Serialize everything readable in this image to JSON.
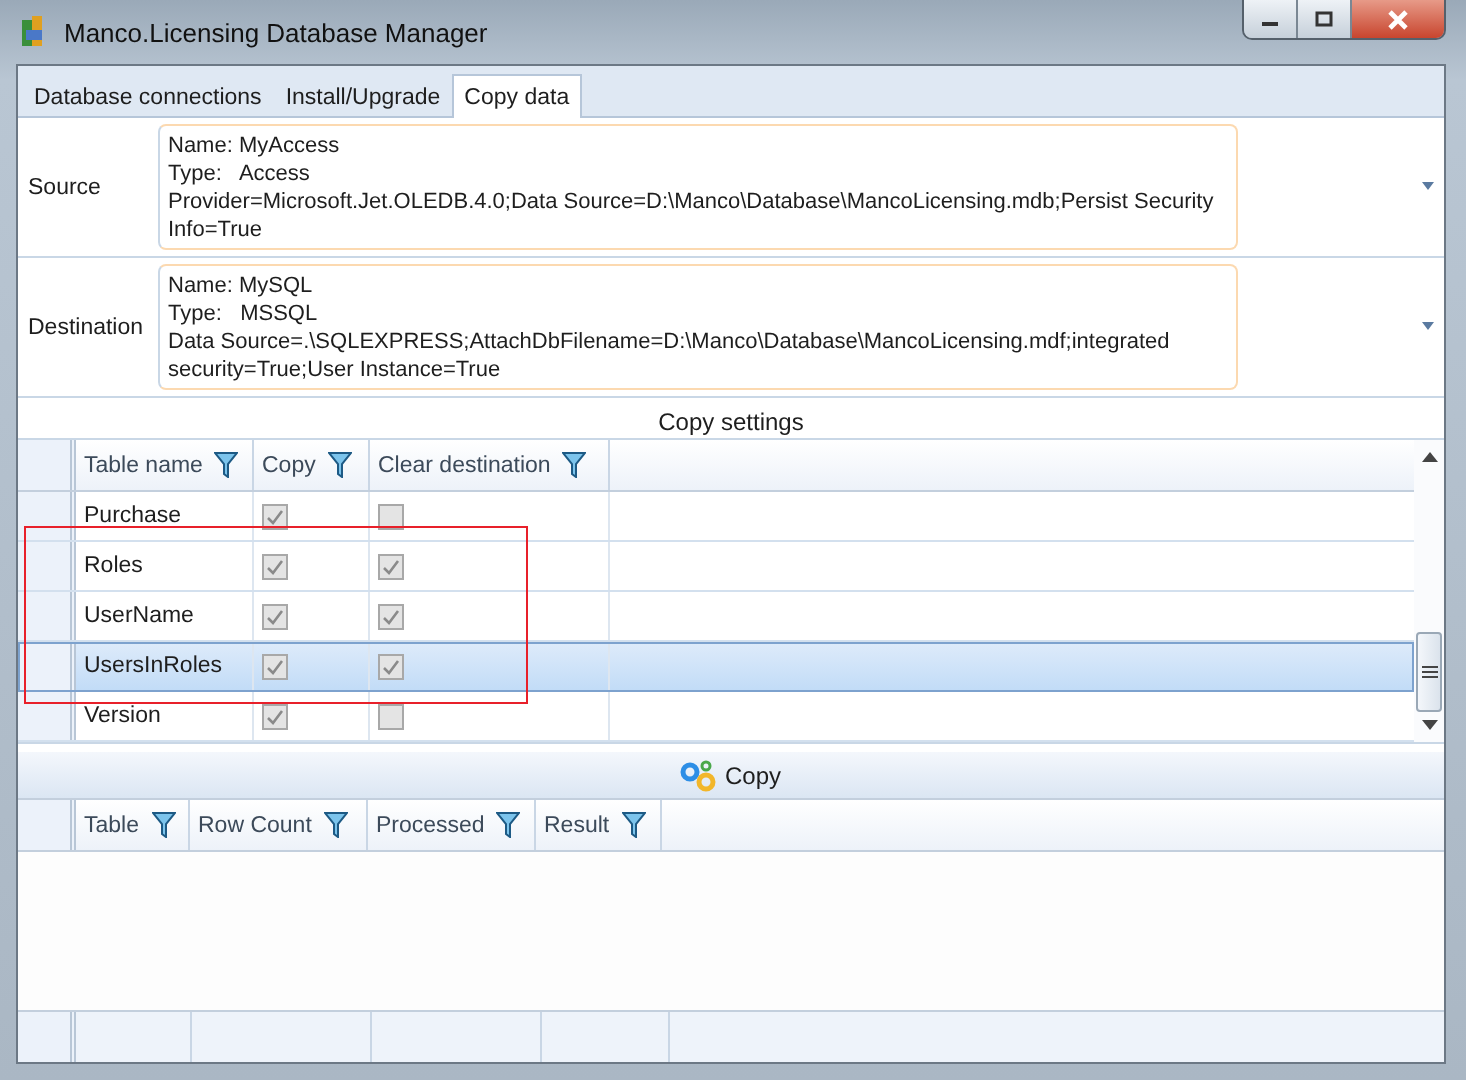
{
  "window": {
    "title": "Manco.Licensing Database Manager"
  },
  "tabs": [
    {
      "label": "Database connections",
      "selected": false
    },
    {
      "label": "Install/Upgrade",
      "selected": false
    },
    {
      "label": "Copy data",
      "selected": true
    }
  ],
  "connections": [
    {
      "label": "Source",
      "lines": [
        "Name: MyAccess",
        "Type:   Access",
        "Provider=Microsoft.Jet.OLEDB.4.0;Data Source=D:\\Manco\\Database\\MancoLicensing.mdb;Persist Security Info=True"
      ]
    },
    {
      "label": "Destination",
      "lines": [
        "Name: MySQL",
        "Type:   MSSQL",
        "Data Source=.\\SQLEXPRESS;AttachDbFilename=D:\\Manco\\Database\\MancoLicensing.mdf;integrated security=True;User Instance=True"
      ]
    }
  ],
  "copy_settings": {
    "title": "Copy settings",
    "columns": [
      "Table name",
      "Copy",
      "Clear destination"
    ],
    "rows": [
      {
        "name": "Purchase",
        "copy": true,
        "clear": false,
        "selected": false
      },
      {
        "name": "Roles",
        "copy": true,
        "clear": true,
        "selected": false
      },
      {
        "name": "UserName",
        "copy": true,
        "clear": true,
        "selected": false
      },
      {
        "name": "UsersInRoles",
        "copy": true,
        "clear": true,
        "selected": true
      },
      {
        "name": "Version",
        "copy": true,
        "clear": false,
        "selected": false
      }
    ]
  },
  "copy_button": {
    "label": "Copy"
  },
  "results": {
    "columns": [
      "Table",
      "Row Count",
      "Processed",
      "Result"
    ]
  }
}
